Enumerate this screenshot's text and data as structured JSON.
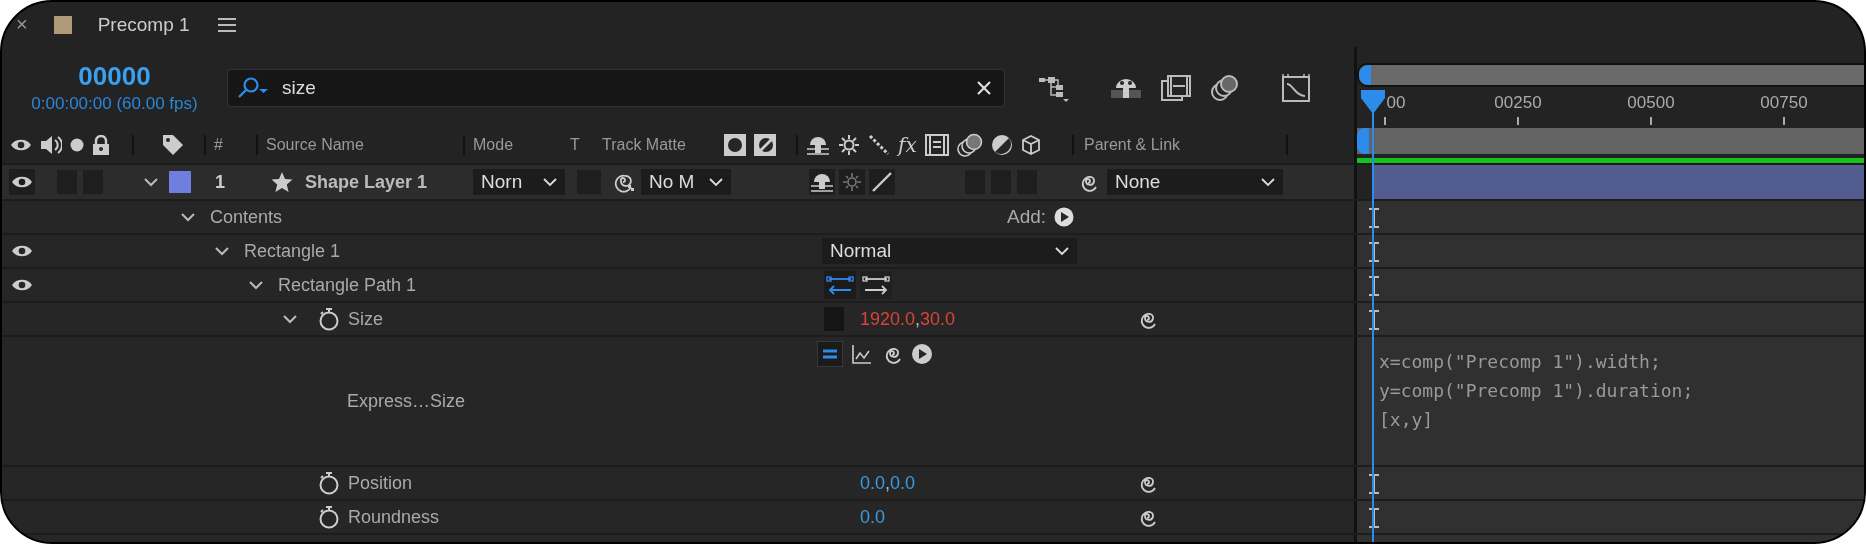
{
  "panel": {
    "close": "×",
    "title": "Precomp 1"
  },
  "timecode": "00000",
  "timecode_detail": "0:00:00:00 (60.00 fps)",
  "search": {
    "value": "size"
  },
  "columns": [
    "#",
    "Source Name",
    "Mode",
    "T",
    "Track Matte",
    "Parent & Link"
  ],
  "effects_switch": "fx",
  "layer": {
    "visible": true,
    "expanded": true,
    "color": "#6e7fe0",
    "number": "1",
    "name": "Shape Layer 1",
    "mode": "Norn",
    "track_matte": "No M",
    "parent": "None"
  },
  "contents": {
    "kind": "group",
    "label": "Contents",
    "expanded": true,
    "add_label": "Add:",
    "children": [
      {
        "kind": "group",
        "label": "Rectangle 1",
        "visible": true,
        "expanded": true,
        "blend_mode": "Normal",
        "children": [
          {
            "kind": "group",
            "label": "Rectangle Path 1",
            "visible": true,
            "expanded": true,
            "path_direction": [
              {
                "selected": true
              },
              {
                "selected": false
              }
            ],
            "children": [
              {
                "kind": "property",
                "label": "Size",
                "expanded": true,
                "values": [
                  "1920.0",
                  "30.0"
                ],
                "separator": ",",
                "has_expression": true,
                "expression": {
                  "enabled": true,
                  "label": "Express…Size",
                  "lines": [
                    "x=comp(\"Precomp 1\").width;",
                    "y=comp(\"Precomp 1\").duration;",
                    "[x,y]"
                  ]
                }
              },
              {
                "kind": "property",
                "label": "Position",
                "values": [
                  "0.0",
                  "0.0"
                ],
                "separator": ",",
                "has_expression": false
              },
              {
                "kind": "property",
                "label": "Roundness",
                "values": [
                  "0.0"
                ],
                "has_expression": false
              }
            ]
          }
        ]
      }
    ]
  },
  "timeline": {
    "ruler": [
      "00",
      "00250",
      "00500",
      "00750"
    ]
  }
}
